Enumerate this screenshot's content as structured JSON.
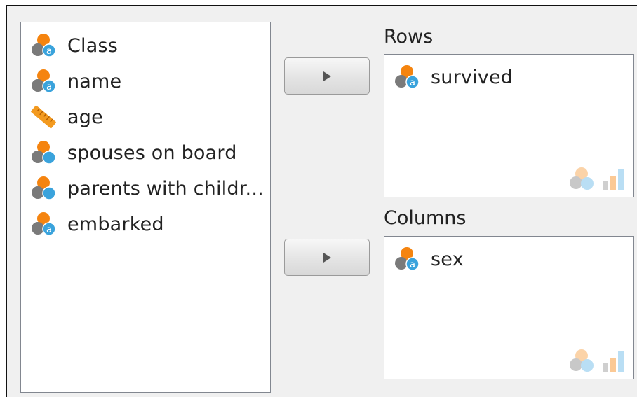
{
  "variables": {
    "items": [
      {
        "label": "Class",
        "icon": "categorical-icon"
      },
      {
        "label": "name",
        "icon": "categorical-icon"
      },
      {
        "label": "age",
        "icon": "numeric-ruler-icon"
      },
      {
        "label": "spouses on board",
        "icon": "categorical-numeric-icon"
      },
      {
        "label": "parents with childr...",
        "icon": "categorical-numeric-icon"
      },
      {
        "label": "embarked",
        "icon": "categorical-icon"
      }
    ]
  },
  "rows": {
    "label": "Rows",
    "items": [
      {
        "label": "survived",
        "icon": "categorical-icon"
      }
    ]
  },
  "columns": {
    "label": "Columns",
    "items": [
      {
        "label": "sex",
        "icon": "categorical-icon"
      }
    ]
  },
  "colors": {
    "orange": "#f5840f",
    "gray": "#7a7a7a",
    "blue": "#3aa3dc",
    "ruler": "#f39a1f"
  }
}
